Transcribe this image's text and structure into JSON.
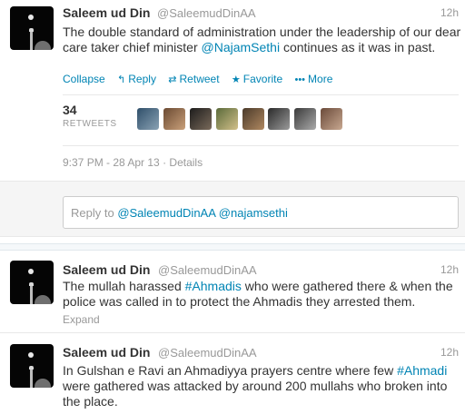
{
  "tweets": [
    {
      "name": "Saleem ud Din",
      "handle": "@SaleemudDinAA",
      "time": "12h",
      "text_before": "The double standard of administration under the leadership of our dear care taker chief minister ",
      "mention": "@NajamSethi",
      "text_after": " continues as it was in past.",
      "actions": {
        "collapse": "Collapse",
        "reply": "Reply",
        "retweet": "Retweet",
        "favorite": "Favorite",
        "more": "More"
      },
      "retweet_count": "34",
      "retweets_label": "RETWEETS",
      "timestamp": "9:37 PM - 28 Apr 13",
      "details": "Details"
    },
    {
      "name": "Saleem ud Din",
      "handle": "@SaleemudDinAA",
      "time": "12h",
      "text_before": "The mullah harassed ",
      "hashtag": "#Ahmadis",
      "text_after": " who were gathered there & when the police was called in to protect the Ahmadis they arrested them.",
      "expand": "Expand"
    },
    {
      "name": "Saleem ud Din",
      "handle": "@SaleemudDinAA",
      "time": "12h",
      "text_before": "In Gulshan e Ravi an Ahmadiyya prayers centre where few ",
      "hashtag": "#Ahmadi",
      "text_after": " were gathered was attacked by around 200 mullahs who broken into the place."
    }
  ],
  "reply_box": {
    "prefix": "Reply to ",
    "mentions": "@SaleemudDinAA @najamsethi"
  },
  "colors": {
    "link": "#0084b4",
    "muted": "#999999",
    "text": "#333333"
  }
}
